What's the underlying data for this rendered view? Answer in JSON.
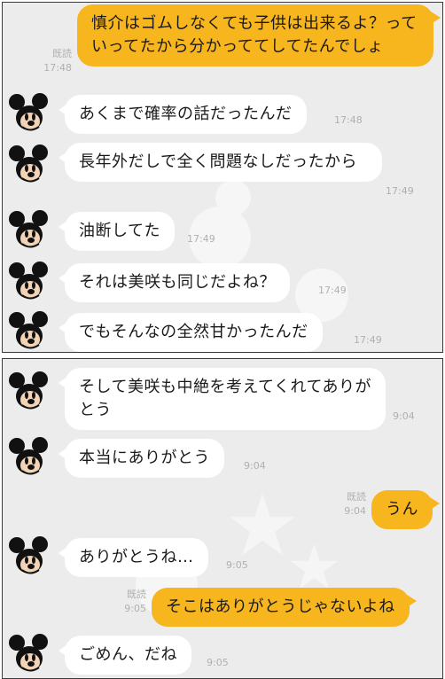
{
  "panel1": {
    "messages": [
      {
        "side": "right",
        "text": "慎介はゴムしなくても子供は出来るよ？っていってたから分かっててしてたんでしょ",
        "read": "既読",
        "time": "17:48"
      },
      {
        "side": "left",
        "text": "あくまで確率の話だったんだ",
        "time": "17:48"
      },
      {
        "side": "left",
        "text": "長年外だしで全く問題なしだったから",
        "time": "17:49"
      },
      {
        "side": "left",
        "text": "油断してた",
        "time": "17:49"
      },
      {
        "side": "left",
        "text": "それは美咲も同じだよね？",
        "time": "17:49"
      },
      {
        "side": "left",
        "text": "でもそんなの全然甘かったんだ",
        "time": "17:49"
      }
    ]
  },
  "panel2": {
    "messages": [
      {
        "side": "left",
        "text": "そして美咲も中絶を考えてくれてありがとう",
        "time": "9:04"
      },
      {
        "side": "left",
        "text": "本当にありがとう",
        "time": "9:04"
      },
      {
        "side": "right",
        "text": "うん",
        "read": "既読",
        "time": "9:04"
      },
      {
        "side": "left",
        "text": "ありがとうね…",
        "time": "9:05"
      },
      {
        "side": "right",
        "text": "そこはありがとうじゃないよね",
        "read": "既読",
        "time": "9:05"
      },
      {
        "side": "left",
        "text": "ごめん、だね",
        "time": "9:05"
      }
    ]
  },
  "icons": {
    "avatar": "mickey-mouse-avatar"
  },
  "colors": {
    "background": "#ececec",
    "incoming_bubble": "#ffffff",
    "outgoing_bubble": "#f7b51e",
    "meta_text": "#b0b0b0"
  }
}
